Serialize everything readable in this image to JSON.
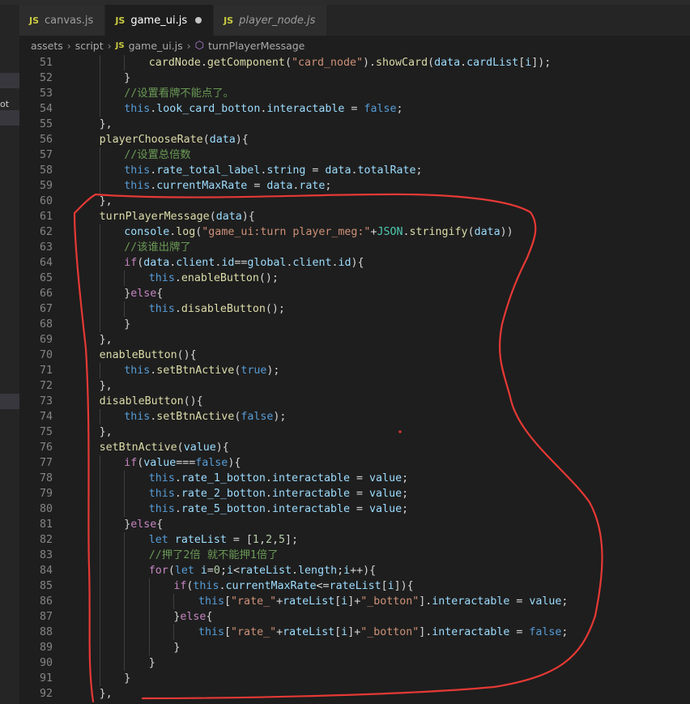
{
  "tabs": [
    {
      "label": "canvas.js",
      "badge": "JS",
      "active": false,
      "italic": false
    },
    {
      "label": "game_ui.js",
      "badge": "JS",
      "active": true,
      "italic": false
    },
    {
      "label": "player_node.js",
      "badge": "JS",
      "active": false,
      "italic": true
    }
  ],
  "sidebar": {
    "partial_text": "ot"
  },
  "breadcrumb": {
    "items": [
      "assets",
      "script",
      "game_ui.js",
      "turnPlayerMessage"
    ],
    "file_badge": "JS"
  },
  "editor": {
    "lines": [
      {
        "n": 51,
        "i": 3,
        "t": [
          [
            "fn",
            "cardNode"
          ],
          [
            "pl",
            "."
          ],
          [
            "fn",
            "getComponent"
          ],
          [
            "pl",
            "("
          ],
          [
            "str",
            "\"card_node\""
          ],
          [
            "pl",
            ")."
          ],
          [
            "fn",
            "showCard"
          ],
          [
            "pl",
            "("
          ],
          [
            "prop",
            "data"
          ],
          [
            "pl",
            "."
          ],
          [
            "prop",
            "cardList"
          ],
          [
            "pl",
            "["
          ],
          [
            "prop",
            "i"
          ],
          [
            "pl",
            "]);"
          ]
        ]
      },
      {
        "n": 52,
        "i": 2,
        "t": [
          [
            "pl",
            "}"
          ]
        ]
      },
      {
        "n": 53,
        "i": 2,
        "t": [
          [
            "cmt",
            "//设置看牌不能点了。"
          ]
        ]
      },
      {
        "n": 54,
        "i": 2,
        "t": [
          [
            "kw",
            "this"
          ],
          [
            "pl",
            "."
          ],
          [
            "prop",
            "look_card_botton"
          ],
          [
            "pl",
            "."
          ],
          [
            "prop",
            "interactable"
          ],
          [
            "pl",
            " = "
          ],
          [
            "kw",
            "false"
          ],
          [
            "pl",
            ";"
          ]
        ]
      },
      {
        "n": 55,
        "i": 1,
        "t": [
          [
            "pl",
            "},"
          ]
        ]
      },
      {
        "n": 56,
        "i": 1,
        "t": [
          [
            "fn",
            "playerChooseRate"
          ],
          [
            "pl",
            "("
          ],
          [
            "prop",
            "data"
          ],
          [
            "pl",
            "){"
          ]
        ]
      },
      {
        "n": 57,
        "i": 2,
        "t": [
          [
            "cmt",
            "//设置总倍数"
          ]
        ]
      },
      {
        "n": 58,
        "i": 2,
        "t": [
          [
            "kw",
            "this"
          ],
          [
            "pl",
            "."
          ],
          [
            "prop",
            "rate_total_label"
          ],
          [
            "pl",
            "."
          ],
          [
            "prop",
            "string"
          ],
          [
            "pl",
            " = "
          ],
          [
            "prop",
            "data"
          ],
          [
            "pl",
            "."
          ],
          [
            "prop",
            "totalRate"
          ],
          [
            "pl",
            ";"
          ]
        ]
      },
      {
        "n": 59,
        "i": 2,
        "t": [
          [
            "kw",
            "this"
          ],
          [
            "pl",
            "."
          ],
          [
            "prop",
            "currentMaxRate"
          ],
          [
            "pl",
            " = "
          ],
          [
            "prop",
            "data"
          ],
          [
            "pl",
            "."
          ],
          [
            "prop",
            "rate"
          ],
          [
            "pl",
            ";"
          ]
        ]
      },
      {
        "n": 60,
        "i": 1,
        "t": [
          [
            "pl",
            "},"
          ]
        ]
      },
      {
        "n": 61,
        "i": 1,
        "t": [
          [
            "fn",
            "turnPlayerMessage"
          ],
          [
            "pl",
            "("
          ],
          [
            "prop",
            "data"
          ],
          [
            "pl",
            "){"
          ]
        ]
      },
      {
        "n": 62,
        "i": 2,
        "t": [
          [
            "prop",
            "console"
          ],
          [
            "pl",
            "."
          ],
          [
            "fn",
            "log"
          ],
          [
            "pl",
            "("
          ],
          [
            "str",
            "\"game_ui:turn player_meg:\""
          ],
          [
            "pl",
            "+"
          ],
          [
            "cls",
            "JSON"
          ],
          [
            "pl",
            "."
          ],
          [
            "fn",
            "stringify"
          ],
          [
            "pl",
            "("
          ],
          [
            "prop",
            "data"
          ],
          [
            "pl",
            "))"
          ]
        ]
      },
      {
        "n": 63,
        "i": 2,
        "t": [
          [
            "cmt",
            "//该谁出牌了"
          ]
        ]
      },
      {
        "n": 64,
        "i": 2,
        "t": [
          [
            "ctl",
            "if"
          ],
          [
            "pl",
            "("
          ],
          [
            "prop",
            "data"
          ],
          [
            "pl",
            "."
          ],
          [
            "prop",
            "client"
          ],
          [
            "pl",
            "."
          ],
          [
            "prop",
            "id"
          ],
          [
            "pl",
            "=="
          ],
          [
            "prop",
            "global"
          ],
          [
            "pl",
            "."
          ],
          [
            "prop",
            "client"
          ],
          [
            "pl",
            "."
          ],
          [
            "prop",
            "id"
          ],
          [
            "pl",
            "){"
          ]
        ]
      },
      {
        "n": 65,
        "i": 3,
        "t": [
          [
            "kw",
            "this"
          ],
          [
            "pl",
            "."
          ],
          [
            "fn",
            "enableButton"
          ],
          [
            "pl",
            "();"
          ]
        ]
      },
      {
        "n": 66,
        "i": 2,
        "t": [
          [
            "pl",
            "}"
          ],
          [
            "ctl",
            "else"
          ],
          [
            "pl",
            "{"
          ]
        ]
      },
      {
        "n": 67,
        "i": 3,
        "t": [
          [
            "kw",
            "this"
          ],
          [
            "pl",
            "."
          ],
          [
            "fn",
            "disableButton"
          ],
          [
            "pl",
            "();"
          ]
        ]
      },
      {
        "n": 68,
        "i": 2,
        "t": [
          [
            "pl",
            "}"
          ]
        ]
      },
      {
        "n": 69,
        "i": 1,
        "t": [
          [
            "pl",
            "},"
          ]
        ]
      },
      {
        "n": 70,
        "i": 1,
        "t": [
          [
            "fn",
            "enableButton"
          ],
          [
            "pl",
            "(){"
          ]
        ]
      },
      {
        "n": 71,
        "i": 2,
        "t": [
          [
            "kw",
            "this"
          ],
          [
            "pl",
            "."
          ],
          [
            "fn",
            "setBtnActive"
          ],
          [
            "pl",
            "("
          ],
          [
            "kw",
            "true"
          ],
          [
            "pl",
            ");"
          ]
        ]
      },
      {
        "n": 72,
        "i": 1,
        "t": [
          [
            "pl",
            "},"
          ]
        ]
      },
      {
        "n": 73,
        "i": 1,
        "t": [
          [
            "fn",
            "disableButton"
          ],
          [
            "pl",
            "(){"
          ]
        ]
      },
      {
        "n": 74,
        "i": 2,
        "t": [
          [
            "kw",
            "this"
          ],
          [
            "pl",
            "."
          ],
          [
            "fn",
            "setBtnActive"
          ],
          [
            "pl",
            "("
          ],
          [
            "kw",
            "false"
          ],
          [
            "pl",
            ");"
          ]
        ]
      },
      {
        "n": 75,
        "i": 1,
        "t": [
          [
            "pl",
            "},"
          ]
        ]
      },
      {
        "n": 76,
        "i": 1,
        "t": [
          [
            "fn",
            "setBtnActive"
          ],
          [
            "pl",
            "("
          ],
          [
            "prop",
            "value"
          ],
          [
            "pl",
            "){"
          ]
        ]
      },
      {
        "n": 77,
        "i": 2,
        "t": [
          [
            "ctl",
            "if"
          ],
          [
            "pl",
            "("
          ],
          [
            "prop",
            "value"
          ],
          [
            "pl",
            "==="
          ],
          [
            "kw",
            "false"
          ],
          [
            "pl",
            "){"
          ]
        ]
      },
      {
        "n": 78,
        "i": 3,
        "t": [
          [
            "kw",
            "this"
          ],
          [
            "pl",
            "."
          ],
          [
            "prop",
            "rate_1_botton"
          ],
          [
            "pl",
            "."
          ],
          [
            "prop",
            "interactable"
          ],
          [
            "pl",
            " = "
          ],
          [
            "prop",
            "value"
          ],
          [
            "pl",
            ";"
          ]
        ]
      },
      {
        "n": 79,
        "i": 3,
        "t": [
          [
            "kw",
            "this"
          ],
          [
            "pl",
            "."
          ],
          [
            "prop",
            "rate_2_botton"
          ],
          [
            "pl",
            "."
          ],
          [
            "prop",
            "interactable"
          ],
          [
            "pl",
            " = "
          ],
          [
            "prop",
            "value"
          ],
          [
            "pl",
            ";"
          ]
        ]
      },
      {
        "n": 80,
        "i": 3,
        "t": [
          [
            "kw",
            "this"
          ],
          [
            "pl",
            "."
          ],
          [
            "prop",
            "rate_5_botton"
          ],
          [
            "pl",
            "."
          ],
          [
            "prop",
            "interactable"
          ],
          [
            "pl",
            " = "
          ],
          [
            "prop",
            "value"
          ],
          [
            "pl",
            ";"
          ]
        ]
      },
      {
        "n": 81,
        "i": 2,
        "t": [
          [
            "pl",
            "}"
          ],
          [
            "ctl",
            "else"
          ],
          [
            "pl",
            "{"
          ]
        ]
      },
      {
        "n": 82,
        "i": 3,
        "t": [
          [
            "kw",
            "let"
          ],
          [
            "pl",
            " "
          ],
          [
            "prop",
            "rateList"
          ],
          [
            "pl",
            " = ["
          ],
          [
            "num",
            "1"
          ],
          [
            "pl",
            ","
          ],
          [
            "num",
            "2"
          ],
          [
            "pl",
            ","
          ],
          [
            "num",
            "5"
          ],
          [
            "pl",
            "];"
          ]
        ]
      },
      {
        "n": 83,
        "i": 3,
        "t": [
          [
            "cmt",
            "//押了2倍 就不能押1倍了"
          ]
        ]
      },
      {
        "n": 84,
        "i": 3,
        "t": [
          [
            "ctl",
            "for"
          ],
          [
            "pl",
            "("
          ],
          [
            "kw",
            "let"
          ],
          [
            "pl",
            " "
          ],
          [
            "prop",
            "i"
          ],
          [
            "pl",
            "="
          ],
          [
            "num",
            "0"
          ],
          [
            "pl",
            ";"
          ],
          [
            "prop",
            "i"
          ],
          [
            "pl",
            "<"
          ],
          [
            "prop",
            "rateList"
          ],
          [
            "pl",
            "."
          ],
          [
            "prop",
            "length"
          ],
          [
            "pl",
            ";"
          ],
          [
            "prop",
            "i"
          ],
          [
            "pl",
            "++){"
          ]
        ]
      },
      {
        "n": 85,
        "i": 4,
        "t": [
          [
            "ctl",
            "if"
          ],
          [
            "pl",
            "("
          ],
          [
            "kw",
            "this"
          ],
          [
            "pl",
            "."
          ],
          [
            "prop",
            "currentMaxRate"
          ],
          [
            "pl",
            "<="
          ],
          [
            "prop",
            "rateList"
          ],
          [
            "pl",
            "["
          ],
          [
            "prop",
            "i"
          ],
          [
            "pl",
            "]){"
          ]
        ]
      },
      {
        "n": 86,
        "i": 5,
        "t": [
          [
            "kw",
            "this"
          ],
          [
            "pl",
            "["
          ],
          [
            "str",
            "\"rate_\""
          ],
          [
            "pl",
            "+"
          ],
          [
            "prop",
            "rateList"
          ],
          [
            "pl",
            "["
          ],
          [
            "prop",
            "i"
          ],
          [
            "pl",
            "]+"
          ],
          [
            "str",
            "\"_botton\""
          ],
          [
            "pl",
            "]."
          ],
          [
            "prop",
            "interactable"
          ],
          [
            "pl",
            " = "
          ],
          [
            "prop",
            "value"
          ],
          [
            "pl",
            ";"
          ]
        ]
      },
      {
        "n": 87,
        "i": 4,
        "t": [
          [
            "pl",
            "}"
          ],
          [
            "ctl",
            "else"
          ],
          [
            "pl",
            "{"
          ]
        ]
      },
      {
        "n": 88,
        "i": 5,
        "t": [
          [
            "kw",
            "this"
          ],
          [
            "pl",
            "["
          ],
          [
            "str",
            "\"rate_\""
          ],
          [
            "pl",
            "+"
          ],
          [
            "prop",
            "rateList"
          ],
          [
            "pl",
            "["
          ],
          [
            "prop",
            "i"
          ],
          [
            "pl",
            "]+"
          ],
          [
            "str",
            "\"_botton\""
          ],
          [
            "pl",
            "]."
          ],
          [
            "prop",
            "interactable"
          ],
          [
            "pl",
            " = "
          ],
          [
            "kw",
            "false"
          ],
          [
            "pl",
            ";"
          ]
        ]
      },
      {
        "n": 89,
        "i": 4,
        "t": [
          [
            "pl",
            "}"
          ]
        ]
      },
      {
        "n": 90,
        "i": 3,
        "t": [
          [
            "pl",
            "}"
          ]
        ]
      },
      {
        "n": 91,
        "i": 2,
        "t": [
          [
            "pl",
            "}"
          ]
        ]
      },
      {
        "n": 92,
        "i": 1,
        "t": [
          [
            "pl",
            "},"
          ]
        ]
      }
    ]
  },
  "colors": {
    "background": "#1e1e1e",
    "annotation": "#e53935",
    "js_badge": "#cbcb41"
  }
}
